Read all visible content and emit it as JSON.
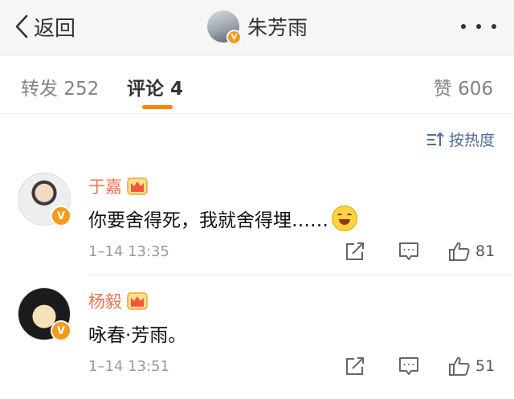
{
  "nav": {
    "back_label": "返回",
    "title": "朱芳雨"
  },
  "tabs": {
    "reposts": "转发 252",
    "comments": "评论 4",
    "likes": "赞 606"
  },
  "sort": {
    "label": "按热度"
  },
  "colors": {
    "accent": "#ff8200",
    "username": "#eb7350",
    "link": "#4b6f97",
    "verified_badge": "#f59a1a"
  },
  "comments": [
    {
      "name": "于嘉",
      "text": "你要舍得死，我就舍得埋……",
      "emoji": "laughing-tears",
      "time": "1–14 13:35",
      "likes": "81"
    },
    {
      "name": "杨毅",
      "text": "咏春·芳雨。",
      "time": "1–14 13:51",
      "likes": "51"
    }
  ],
  "badges": {
    "verified_symbol": "V"
  }
}
